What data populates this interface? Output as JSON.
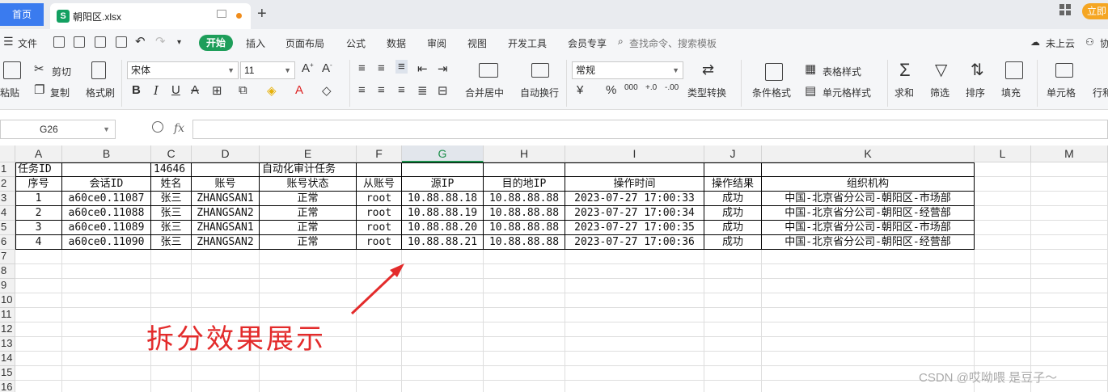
{
  "tabbar": {
    "home_tab": "首页",
    "file_tab": "朝阳区.xlsx",
    "new_tab": "+",
    "login_button": "立即"
  },
  "menu": {
    "file": "文件",
    "items": [
      "开始",
      "插入",
      "页面布局",
      "公式",
      "数据",
      "审阅",
      "视图",
      "开发工具",
      "会员专享"
    ],
    "search_placeholder": "查找命令、搜索模板",
    "cloud": "未上云",
    "share": "协"
  },
  "ribbon": {
    "paste": "粘贴",
    "cut": "剪切",
    "copy": "复制",
    "format_painter": "格式刷",
    "font_name": "宋体",
    "font_size": "11",
    "merge": "合并居中",
    "wrap": "自动换行",
    "number_format": "常规",
    "convert": "类型转换",
    "cond_format": "条件格式",
    "table_style": "表格样式",
    "cell_style": "单元格样式",
    "sum": "求和",
    "filter": "筛选",
    "sort": "排序",
    "fill": "填充",
    "cell": "单元格",
    "rowcol": "行和"
  },
  "formula_bar": {
    "name_box": "G26",
    "fx": "fx",
    "value": ""
  },
  "sheet": {
    "columns": [
      "A",
      "B",
      "C",
      "D",
      "E",
      "F",
      "G",
      "H",
      "I",
      "J",
      "K",
      "L",
      "M"
    ],
    "selected_column": "G",
    "row_numbers": [
      "1",
      "2",
      "3",
      "4",
      "5",
      "6",
      "7",
      "8",
      "9",
      "10",
      "11",
      "12",
      "13",
      "14",
      "15",
      "16"
    ],
    "row1": {
      "A": "任务ID",
      "C": "14646",
      "E": "自动化审计任务"
    },
    "headers": [
      "序号",
      "会话ID",
      "姓名",
      "账号",
      "账号状态",
      "从账号",
      "源IP",
      "目的地IP",
      "操作时间",
      "操作结果",
      "组织机构"
    ],
    "rows": [
      [
        "1",
        "a60ce0.11087",
        "张三",
        "ZHANGSAN1",
        "正常",
        "root",
        "10.88.88.18",
        "10.88.88.88",
        "2023-07-27 17:00:33",
        "成功",
        "中国-北京省分公司-朝阳区-市场部"
      ],
      [
        "2",
        "a60ce0.11088",
        "张三",
        "ZHANGSAN2",
        "正常",
        "root",
        "10.88.88.19",
        "10.88.88.88",
        "2023-07-27 17:00:34",
        "成功",
        "中国-北京省分公司-朝阳区-经营部"
      ],
      [
        "3",
        "a60ce0.11089",
        "张三",
        "ZHANGSAN1",
        "正常",
        "root",
        "10.88.88.20",
        "10.88.88.88",
        "2023-07-27 17:00:35",
        "成功",
        "中国-北京省分公司-朝阳区-市场部"
      ],
      [
        "4",
        "a60ce0.11090",
        "张三",
        "ZHANGSAN2",
        "正常",
        "root",
        "10.88.88.21",
        "10.88.88.88",
        "2023-07-27 17:00:36",
        "成功",
        "中国-北京省分公司-朝阳区-经营部"
      ]
    ]
  },
  "annotation": {
    "text": "拆分效果展示",
    "color": "#e32b2b"
  },
  "watermark": "CSDN @哎呦喂 是豆子～"
}
